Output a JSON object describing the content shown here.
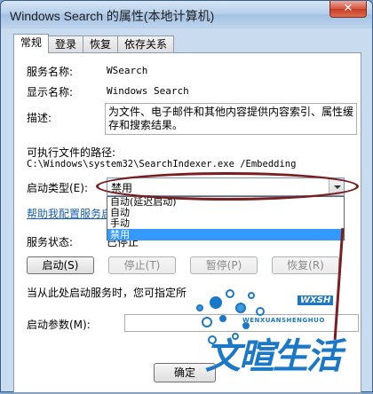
{
  "window": {
    "title": "Windows Search 的属性(本地计算机)",
    "close_glyph": "✕"
  },
  "tabs": [
    {
      "label": "常规",
      "active": true
    },
    {
      "label": "登录",
      "active": false
    },
    {
      "label": "恢复",
      "active": false
    },
    {
      "label": "依存关系",
      "active": false
    }
  ],
  "general": {
    "service_name_label": "服务名称:",
    "service_name_value": "WSearch",
    "display_name_label": "显示名称:",
    "display_name_value": "Windows Search",
    "description_label": "描述:",
    "description_value": "为文件、电子邮件和其他内容提供内容索引、属性缓存和搜索结果。",
    "exe_path_label": "可执行文件的路径:",
    "exe_path_value": "C:\\Windows\\system32\\SearchIndexer.exe /Embedding",
    "startup_type_label": "启动类型(E):",
    "startup_type_value": "禁用",
    "startup_options": [
      "自动(延迟启动)",
      "自动",
      "手动",
      "禁用"
    ],
    "help_link": "帮助我配置服务启",
    "service_status_label": "服务状态:",
    "service_status_value": "已停止",
    "hint_text": "当从此处启动服务时，您可指定所",
    "start_params_label": "启动参数(M):"
  },
  "buttons": {
    "start": "启动(S)",
    "stop": "停止(T)",
    "pause": "暂停(P)",
    "resume": "恢复(R)",
    "ok": "确定"
  },
  "watermark": {
    "brand": "文暄生活",
    "pinyin": "WENXUANSHENGHUO",
    "badge": "WXSH"
  },
  "colors": {
    "accent_blue": "#3399ff",
    "annotation_red": "#7a1f1f",
    "watermark_blue": "#1b78c8"
  }
}
